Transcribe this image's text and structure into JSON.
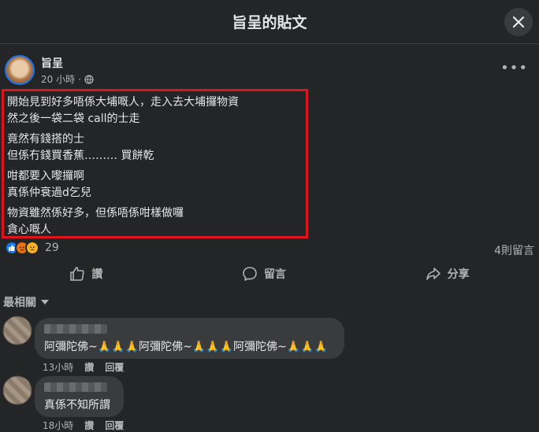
{
  "header": {
    "title": "旨呈的貼文"
  },
  "post": {
    "author": "旨呈",
    "time": "20 小時",
    "separator": "·",
    "paragraphs": [
      {
        "line1": "開始見到好多唔係大埔嘅人，走入去大埔攞物資",
        "line2": "然之後一袋二袋 call的士走"
      },
      {
        "line1": "竟然有錢搭的士",
        "line2": "但係冇錢買香蕉……… 買餅乾 "
      },
      {
        "line1": "咁都要入嚟攞啊",
        "line2": "真係仲衰過d乞兒"
      },
      {
        "line1": "物資雖然係好多，但係唔係咁樣做囉",
        "line2": "貪心嘅人"
      }
    ],
    "reaction_count": "29",
    "comment_count": "4則留言"
  },
  "actions": {
    "like": "讚",
    "comment": "留言",
    "share": "分享"
  },
  "sort_label": "最相關",
  "comments": [
    {
      "text": "阿彌陀佛~🙏🙏🙏阿彌陀佛~🙏🙏🙏阿彌陀佛~🙏🙏🙏",
      "time": "13小時",
      "like": "讚",
      "reply": "回覆"
    },
    {
      "text": "真係不知所謂",
      "time": "18小時",
      "like": "讚",
      "reply": "回覆"
    }
  ]
}
